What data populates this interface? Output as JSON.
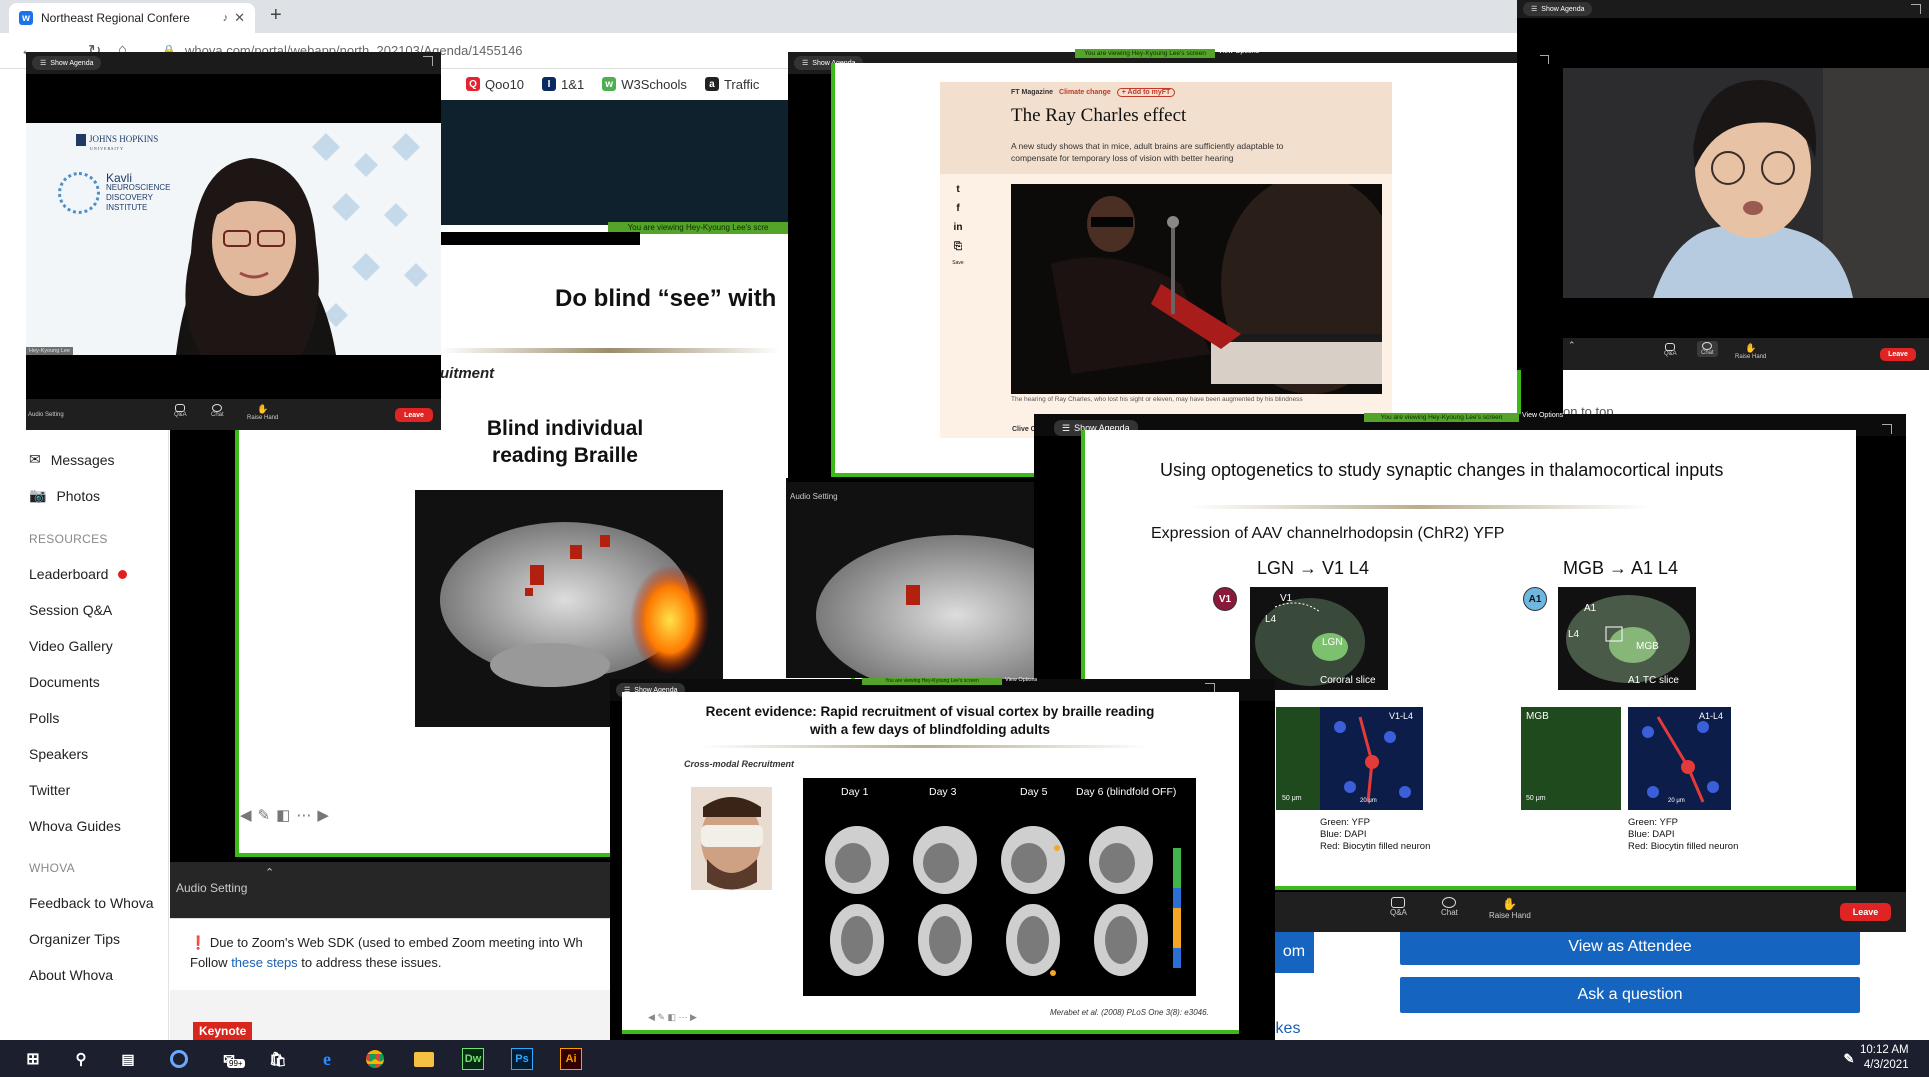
{
  "browser": {
    "tab_title": "Northeast Regional Confere",
    "url": "whova.com/portal/webapp/north_202103/Agenda/1455146",
    "bookmarks": [
      {
        "label": "Qoo10",
        "color": "#e4232e",
        "icon": "Q"
      },
      {
        "label": "1&1",
        "color": "#0b2a63",
        "icon": "I"
      },
      {
        "label": "W3Schools",
        "color": "#4caf50",
        "icon": "w3"
      },
      {
        "label": "Traffic",
        "color": "#222222",
        "icon": "a"
      }
    ]
  },
  "sidebar": {
    "items_top": [
      {
        "label": "Messages",
        "icon": "envelope-icon"
      },
      {
        "label": "Photos",
        "icon": "camera-icon"
      }
    ],
    "resources_heading": "RESOURCES",
    "resources": [
      "Leaderboard",
      "Session Q&A",
      "Video Gallery",
      "Documents",
      "Polls",
      "Speakers",
      "Twitter",
      "Whova Guides"
    ],
    "whova_heading": "WHOVA",
    "whova": [
      "Feedback to Whova",
      "Organizer Tips",
      "About Whova"
    ]
  },
  "notice": {
    "line1": "Due to Zoom's Web SDK (used to embed Zoom meeting into Wh",
    "line2_pre": "Follow ",
    "line2_link": "these steps",
    "line2_post": " to address these issues."
  },
  "keynote_badge": "Keynote",
  "actions": {
    "view_as_attendee": "View as Attendee",
    "ask_question": "Ask a question",
    "likes_fragment": "ikes",
    "top_fragment": "on to top",
    "zoom_fragment": "om"
  },
  "zoom": {
    "show_agenda": "Show Agenda",
    "audio_setting": "Audio Setting",
    "qa": "Q&A",
    "chat": "Chat",
    "raise_hand": "Raise Hand",
    "leave": "Leave",
    "viewing_banner": "You are viewing Hey-Kyoung Lee's screen",
    "viewing_banner_cut": "You are viewing Hey-Kyoung Lee's scre",
    "view_options": "View Options"
  },
  "cam1": {
    "institution": "JOHNS HOPKINS",
    "institution_sub": "UNIVERSITY",
    "kavli": [
      "Kavli",
      "NEUROSCIENCE",
      "DISCOVERY",
      "INSTITUTE"
    ],
    "name_tag": "Hey-Kyoung Lee"
  },
  "braille_slide": {
    "title": "Do blind “see” with",
    "section": "uitment",
    "caption_line1": "Blind individual",
    "caption_line2": "reading Braille"
  },
  "ray_charles": {
    "mag": "FT Magazine",
    "topic": "Climate change",
    "add": "+ Add to myFT",
    "title": "The Ray Charles effect",
    "subtitle": "A new study shows that in mice, adult brains are sufficiently adaptable to compensate for temporary loss of vision with better hearing",
    "caption": "The hearing of Ray Charles, who lost his sight or eleven, may have been augmented by his blindness",
    "author": "Clive C",
    "social": [
      "t",
      "f",
      "in",
      "⎘"
    ],
    "save": "Save"
  },
  "opto": {
    "title": "Using optogenetics to study synaptic changes in thalamocortical inputs",
    "expression": "Expression of AAV channelrhodopsin (ChR2) YFP",
    "left_head": "LGN → V1 L4",
    "right_head": "MGB → A1 L4",
    "left_badge": "V1",
    "right_badge": "A1",
    "left_slice_label": "Cororal slice",
    "right_slice_label": "A1 TC slice",
    "left_slice_tags": [
      "V1",
      "L4",
      "LGN"
    ],
    "right_slice_tags": [
      "A1",
      "L4",
      "MGB"
    ],
    "left_micro_label": "V1-L4",
    "right_micro_labels": [
      "MGB",
      "A1-L4"
    ],
    "scale_50": "50 μm",
    "scale_20": "20 μm",
    "legend": [
      "Green: YFP",
      "Blue: DAPI",
      "Red: Biocytin filled neuron"
    ],
    "badge_colors": {
      "v1": "#8b1a3a",
      "a1": "#6fb7e0"
    }
  },
  "recent": {
    "title_line1": "Recent evidence: Rapid recruitment of visual cortex by braille reading",
    "title_line2": "with a few days of blindfolding adults",
    "cross_modal": "Cross-modal Recruitment",
    "days": [
      "Day 1",
      "Day 3",
      "Day 5",
      "Day 6 (blindfold OFF)"
    ],
    "citation": "Merabet et al. (2008) PLoS One 3(8): e3046."
  },
  "taskbar": {
    "badge": "99+",
    "time": "10:12 AM",
    "date": "4/3/2021",
    "apps": [
      "Dw",
      "Ps",
      "Ai"
    ]
  },
  "colors": {
    "zoom_green": "#3dba1a",
    "leave_red": "#e02424",
    "whova_blue": "#1565c0",
    "keynote_red": "#d9261c"
  }
}
